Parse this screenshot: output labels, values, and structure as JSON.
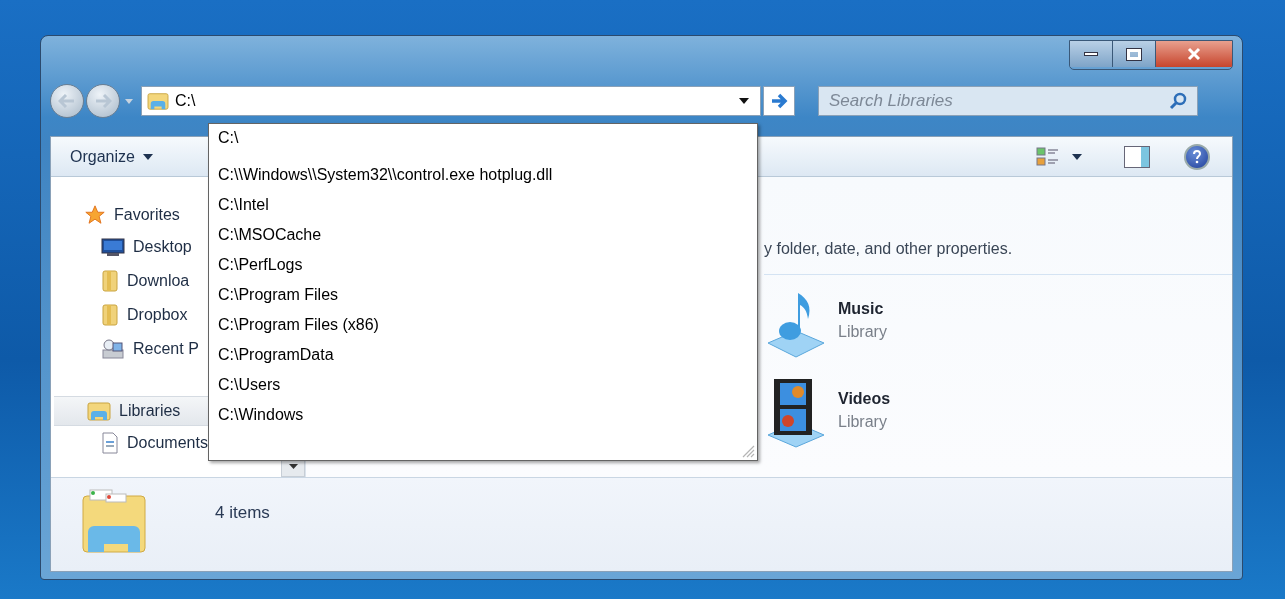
{
  "address_bar": {
    "value": "C:\\"
  },
  "autocomplete": {
    "items": [
      "C:\\",
      "C:\\\\Windows\\\\System32\\\\control.exe hotplug.dll",
      "C:\\Intel",
      "C:\\MSOCache",
      "C:\\PerfLogs",
      "C:\\Program Files",
      "C:\\Program Files (x86)",
      "C:\\ProgramData",
      "C:\\Users",
      "C:\\Windows"
    ]
  },
  "search": {
    "placeholder": "Search Libraries"
  },
  "toolbar": {
    "organize": "Organize"
  },
  "sidebar": {
    "groups": [
      {
        "label": "Favorites",
        "kind": "favorites",
        "selected": false,
        "children": [
          {
            "label": "Desktop",
            "kind": "desktop"
          },
          {
            "label": "Downloa",
            "kind": "folder"
          },
          {
            "label": "Dropbox",
            "kind": "folder"
          },
          {
            "label": "Recent P",
            "kind": "recent"
          }
        ]
      },
      {
        "label": "Libraries",
        "kind": "libraries",
        "selected": true,
        "children": [
          {
            "label": "Documents",
            "kind": "document"
          }
        ]
      }
    ]
  },
  "content": {
    "description": "y folder, date, and other properties.",
    "libraries": [
      {
        "name": "Music",
        "type": "Library",
        "kind": "music"
      },
      {
        "name": "Videos",
        "type": "Library",
        "kind": "videos"
      }
    ]
  },
  "status_bar": {
    "count": "4 items"
  }
}
